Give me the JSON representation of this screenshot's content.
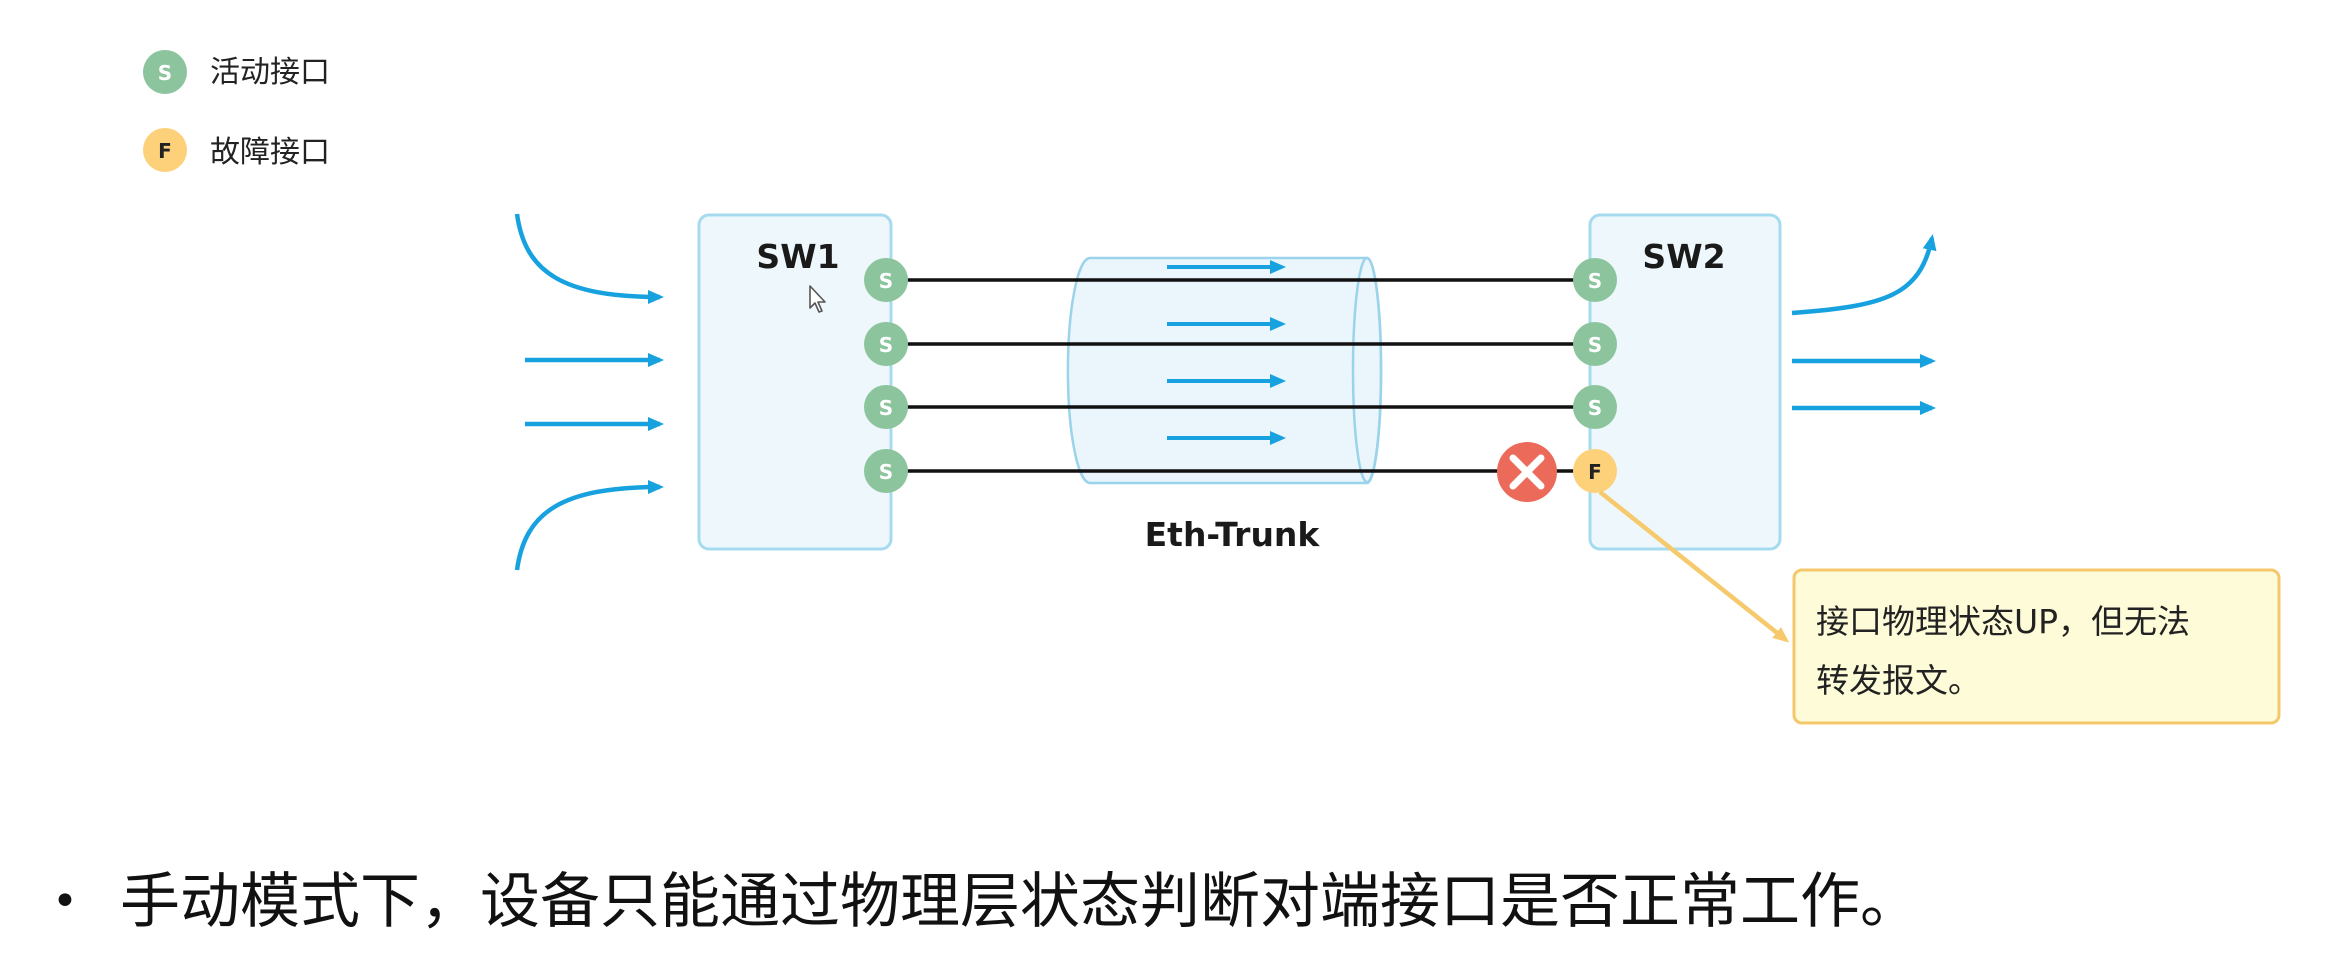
{
  "legend": [
    {
      "label": "S",
      "text": "活动接口"
    },
    {
      "label": "F",
      "text": "故障接口"
    }
  ],
  "sw1": {
    "title": "SW1",
    "ports": [
      "S",
      "S",
      "S",
      "S"
    ]
  },
  "sw2": {
    "title": "SW2",
    "ports": [
      "S",
      "S",
      "S",
      "F"
    ]
  },
  "trunk": {
    "label": "Eth-Trunk"
  },
  "callout": {
    "line1": "接口物理状态UP，但无法",
    "line2": "转发报文。"
  },
  "bullet": {
    "marker": "•",
    "text": "手动模式下，设备只能通过物理层状态判断对端接口是否正常工作。"
  },
  "colors": {
    "active_port": "#8cc49e",
    "fault_port": "#fdd07a",
    "flow_arrow": "#17a2df",
    "switch_fill": "#eef8fc",
    "switch_stroke": "#a6dbef",
    "fault_mark": "#ec6a5a",
    "callout_fill": "#fdfbd8",
    "callout_stroke": "#f4c76a"
  },
  "icons": {
    "fault": "close-circle-icon",
    "pointer": "mouse-cursor-icon"
  }
}
